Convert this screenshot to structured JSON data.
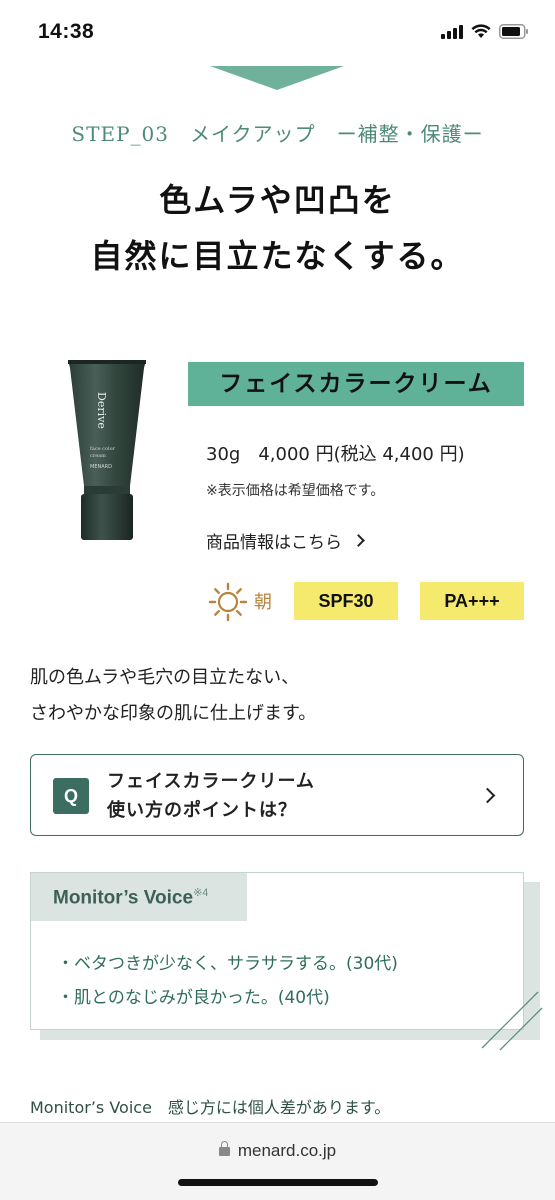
{
  "status_bar": {
    "time": "14:38"
  },
  "step_label": "STEP_03　メイクアップ　ー補整・保護ー",
  "headline": {
    "line1": "色ムラや凹凸を",
    "line2": "自然に目立たなくする。"
  },
  "product": {
    "tube_brand": "Derive",
    "tube_desc_line1": "face color",
    "tube_desc_line2": "cream",
    "tube_maker": "MENARD",
    "name": "フェイスカラークリーム",
    "price": "30g　4,000 円(税込 4,400 円)",
    "price_note": "※表示価格は希望価格です。",
    "info_link": "商品情報はこちら"
  },
  "usage": {
    "time_label": "朝",
    "spf": "SPF30",
    "pa": "PA+++",
    "sun_icon": "sun-icon"
  },
  "description": {
    "line1": "肌の色ムラや毛穴の目立たない、",
    "line2": "さわやかな印象の肌に仕上げます。"
  },
  "howto": {
    "q_label": "Q",
    "line1": "フェイスカラークリーム",
    "line2": "使い方のポイントは？"
  },
  "monitor_voice": {
    "title": "Monitor’s Voice",
    "footnote": "※4",
    "items": [
      "・ベタつきが少なく、サラサラする。(30代)",
      "・肌とのなじみが良かった。(40代)"
    ]
  },
  "disclaimer": "Monitor’s Voice　感じ方には個人差があります。",
  "browser": {
    "url": "menard.co.jp"
  },
  "colors": {
    "accent_green": "#5fb297",
    "dark_green": "#3b6e60",
    "badge_yellow": "#f6ea6e",
    "sun_gold": "#b8843c"
  }
}
